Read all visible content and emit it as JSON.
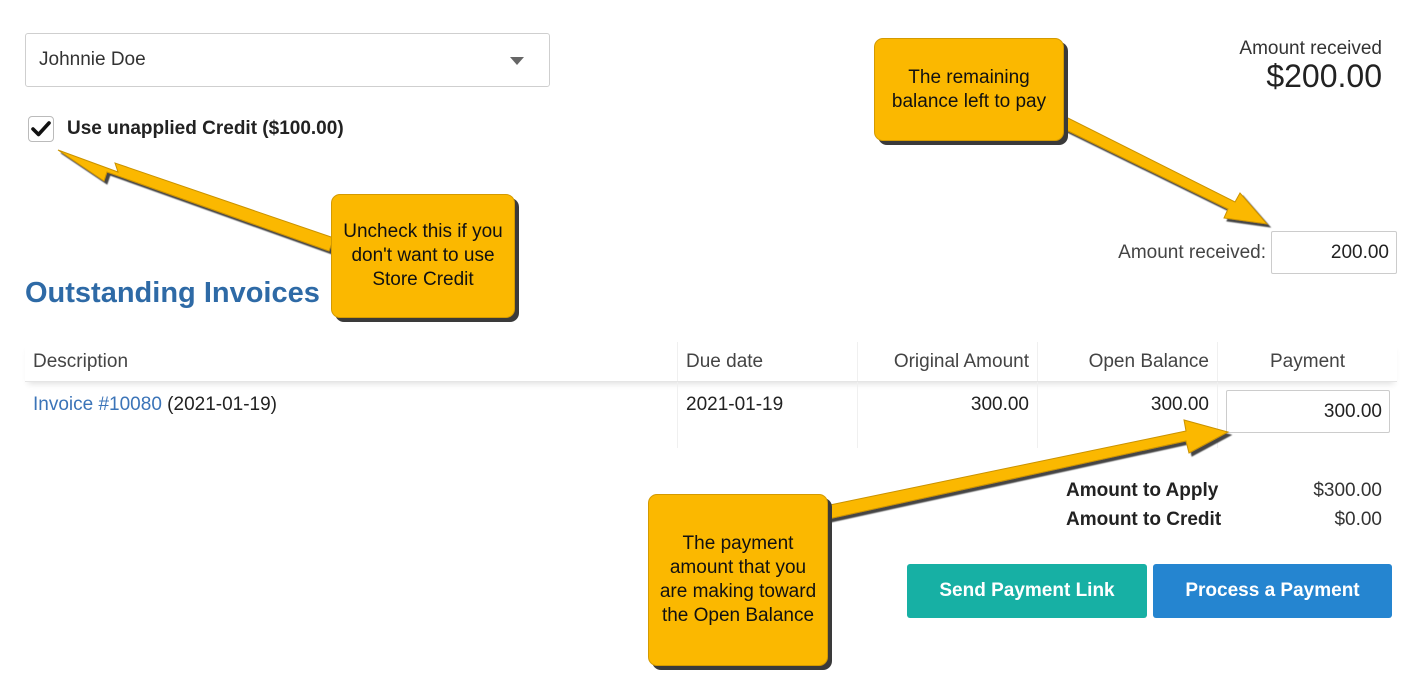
{
  "customer": {
    "selected": "Johnnie Doe"
  },
  "credit": {
    "checked": true,
    "label": "Use unapplied Credit ($100.00)"
  },
  "amount_received_display": {
    "label": "Amount received",
    "value": "$200.00"
  },
  "amount_received_input": {
    "label": "Amount received:",
    "value": "200.00"
  },
  "section_title": "Outstanding Invoices",
  "table": {
    "headers": [
      "Description",
      "Due date",
      "Original Amount",
      "Open Balance",
      "Payment"
    ],
    "rows": [
      {
        "invoice_link": "Invoice #10080",
        "invoice_date": " (2021-01-19)",
        "due_date": "2021-01-19",
        "original_amount": "300.00",
        "open_balance": "300.00",
        "payment": "300.00"
      }
    ]
  },
  "summary": {
    "apply_label": "Amount to Apply",
    "apply_value": "$300.00",
    "credit_label": "Amount to Credit",
    "credit_value": "$0.00"
  },
  "buttons": {
    "send_link": "Send Payment Link",
    "process_payment": "Process a Payment"
  },
  "callouts": {
    "balance": "The remaining balance left to pay",
    "credit": "Uncheck this if you don't want to use Store Credit",
    "payment": "The payment amount that you are making toward the Open Balance"
  },
  "colors": {
    "callout": "#fbb800",
    "title": "#2e6aa6",
    "link": "#3b74b8",
    "btn_teal": "#17b0a4",
    "btn_blue": "#2585d0"
  },
  "icons": [
    "caret-down-icon",
    "checkmark-icon"
  ]
}
